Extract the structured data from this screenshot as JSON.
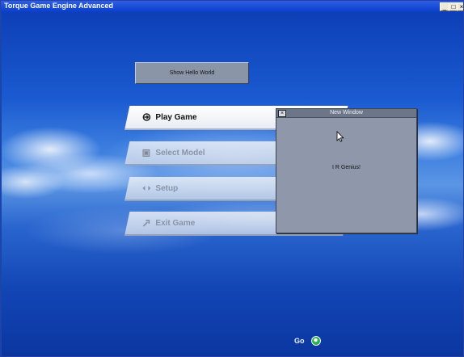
{
  "window": {
    "title": "Torque Game Engine Advanced",
    "controls": {
      "minimize": "_",
      "maximize": "□",
      "close": "×"
    }
  },
  "hello_button": {
    "label": "Show Hello World"
  },
  "menu": {
    "items": [
      {
        "label": "Play Game",
        "icon": "play-icon",
        "state": "active"
      },
      {
        "label": "Select Model",
        "icon": "model-icon",
        "state": "inactive"
      },
      {
        "label": "Setup",
        "icon": "setup-icon",
        "state": "inactive"
      },
      {
        "label": "Exit Game",
        "icon": "exit-icon",
        "state": "inactive"
      }
    ]
  },
  "new_window": {
    "title": "New Window",
    "close": "×",
    "text": "I R Genius!"
  },
  "go": {
    "label": "Go"
  },
  "colors": {
    "window_titlebar": "#0a3ec8",
    "dialog_bg": "#8e98aa",
    "go_button": "#2fb24a"
  }
}
